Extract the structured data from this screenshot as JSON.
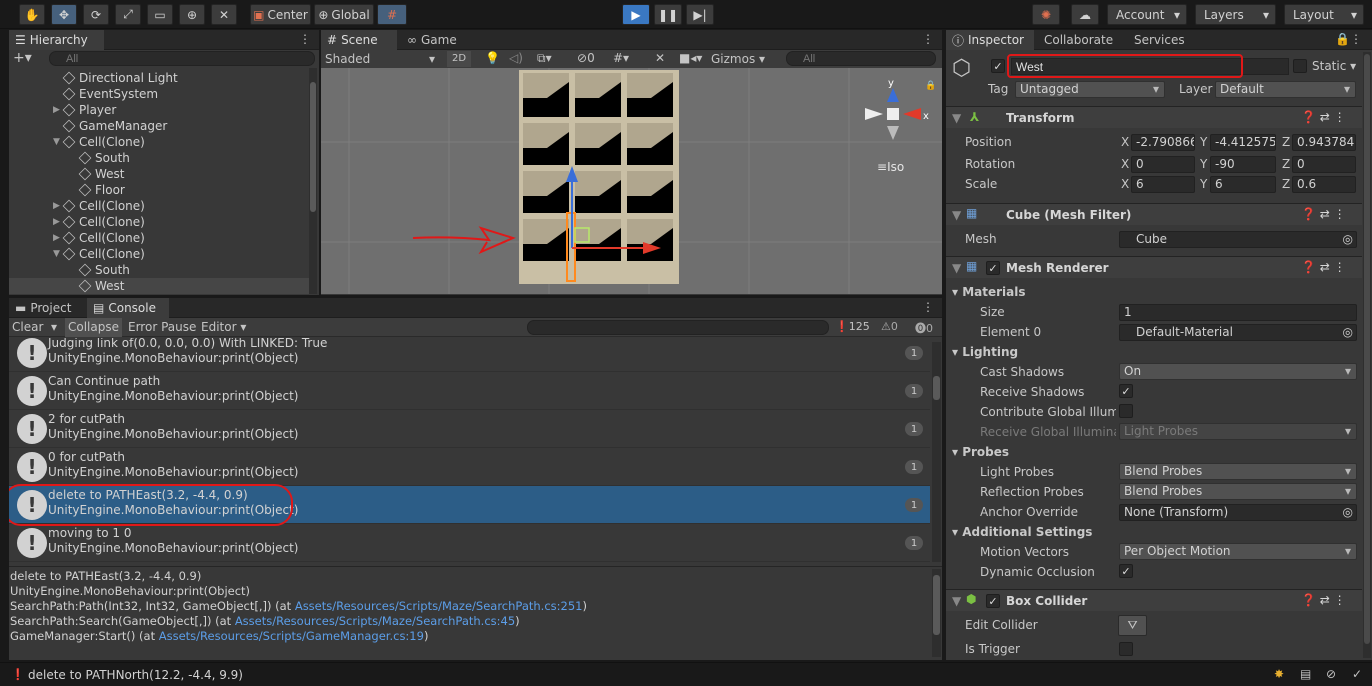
{
  "toolbar": {
    "center": "Center",
    "global": "Global",
    "account": "Account",
    "layers": "Layers",
    "layout": "Layout"
  },
  "hierarchy": {
    "title": "Hierarchy",
    "search_placeholder": "All",
    "items": [
      {
        "label": "Directional Light"
      },
      {
        "label": "EventSystem"
      },
      {
        "label": "Player"
      },
      {
        "label": "GameManager"
      },
      {
        "label": "Cell(Clone)"
      },
      {
        "label": "South"
      },
      {
        "label": "West"
      },
      {
        "label": "Floor"
      },
      {
        "label": "Cell(Clone)"
      },
      {
        "label": "Cell(Clone)"
      },
      {
        "label": "Cell(Clone)"
      },
      {
        "label": "Cell(Clone)"
      },
      {
        "label": "South"
      },
      {
        "label": "West"
      }
    ]
  },
  "scene": {
    "tab_scene": "Scene",
    "tab_game": "Game",
    "shading": "Shaded",
    "mode2d": "2D",
    "hidden_count": "0",
    "gizmos": "Gizmos",
    "search_placeholder": "All",
    "view_label": "Iso",
    "axis_y": "y",
    "axis_x": "x"
  },
  "console": {
    "tab_project": "Project",
    "tab_console": "Console",
    "clear": "Clear",
    "collapse": "Collapse",
    "error_pause": "Error Pause",
    "editor": "Editor",
    "warn_count": "125",
    "warn2_count": "0",
    "err_count": "0",
    "entries": [
      {
        "line1": "Judging link of(0.0, 0.0, 0.0) With LINKED: True",
        "line2": "UnityEngine.MonoBehaviour:print(Object)",
        "count": "1"
      },
      {
        "line1": "Can Continue path",
        "line2": "UnityEngine.MonoBehaviour:print(Object)",
        "count": "1"
      },
      {
        "line1": "2 for cutPath",
        "line2": "UnityEngine.MonoBehaviour:print(Object)",
        "count": "1"
      },
      {
        "line1": "0 for cutPath",
        "line2": "UnityEngine.MonoBehaviour:print(Object)",
        "count": "1"
      },
      {
        "line1": "delete to PATHEast(3.2, -4.4, 0.9)",
        "line2": "UnityEngine.MonoBehaviour:print(Object)",
        "count": "1"
      },
      {
        "line1": "moving to 1 0",
        "line2": "UnityEngine.MonoBehaviour:print(Object)",
        "count": "1"
      }
    ],
    "detail": {
      "l1": "delete to PATHEast(3.2, -4.4, 0.9)",
      "l2": "UnityEngine.MonoBehaviour:print(Object)",
      "l3a": "SearchPath:Path(Int32, Int32, GameObject[,]) (at ",
      "l3b": "Assets/Resources/Scripts/Maze/SearchPath.cs:251",
      "l3c": ")",
      "l4a": "SearchPath:Search(GameObject[,]) (at ",
      "l4b": "Assets/Resources/Scripts/Maze/SearchPath.cs:45",
      "l4c": ")",
      "l5a": "GameManager:Start() (at ",
      "l5b": "Assets/Resources/Scripts/GameManager.cs:19",
      "l5c": ")"
    }
  },
  "status": {
    "message": "delete to PATHNorth(12.2, -4.4, 9.9)"
  },
  "inspector": {
    "tab_inspector": "Inspector",
    "tab_collaborate": "Collaborate",
    "tab_services": "Services",
    "object_name": "West",
    "static_label": "Static",
    "tag_label": "Tag",
    "tag_value": "Untagged",
    "layer_label": "Layer",
    "layer_value": "Default",
    "transform": {
      "title": "Transform",
      "position": "Position",
      "rotation": "Rotation",
      "scale": "Scale",
      "pos": [
        "-2.790866",
        "-4.412575",
        "0.9437841"
      ],
      "rot": [
        "0",
        "-90",
        "0"
      ],
      "scl": [
        "6",
        "6",
        "0.6"
      ],
      "x": "X",
      "y": "Y",
      "z": "Z"
    },
    "meshfilter": {
      "title": "Cube (Mesh Filter)",
      "mesh_label": "Mesh",
      "mesh_value": "Cube"
    },
    "meshrenderer": {
      "title": "Mesh Renderer",
      "materials": "Materials",
      "size_label": "Size",
      "size_value": "1",
      "element0_label": "Element 0",
      "element0_value": "Default-Material",
      "lighting": "Lighting",
      "cast_shadows": "Cast Shadows",
      "cast_shadows_value": "On",
      "receive_shadows": "Receive Shadows",
      "contribute_gi": "Contribute Global Illumin",
      "receive_gi": "Receive Global Illuminati",
      "receive_gi_value": "Light Probes",
      "probes": "Probes",
      "light_probes": "Light Probes",
      "light_probes_value": "Blend Probes",
      "reflection_probes": "Reflection Probes",
      "reflection_probes_value": "Blend Probes",
      "anchor_override": "Anchor Override",
      "anchor_override_value": "None (Transform)",
      "additional": "Additional Settings",
      "motion_vectors": "Motion Vectors",
      "motion_vectors_value": "Per Object Motion",
      "dynamic_occlusion": "Dynamic Occlusion"
    },
    "boxcollider": {
      "title": "Box Collider",
      "edit_collider": "Edit Collider",
      "is_trigger": "Is Trigger"
    }
  }
}
